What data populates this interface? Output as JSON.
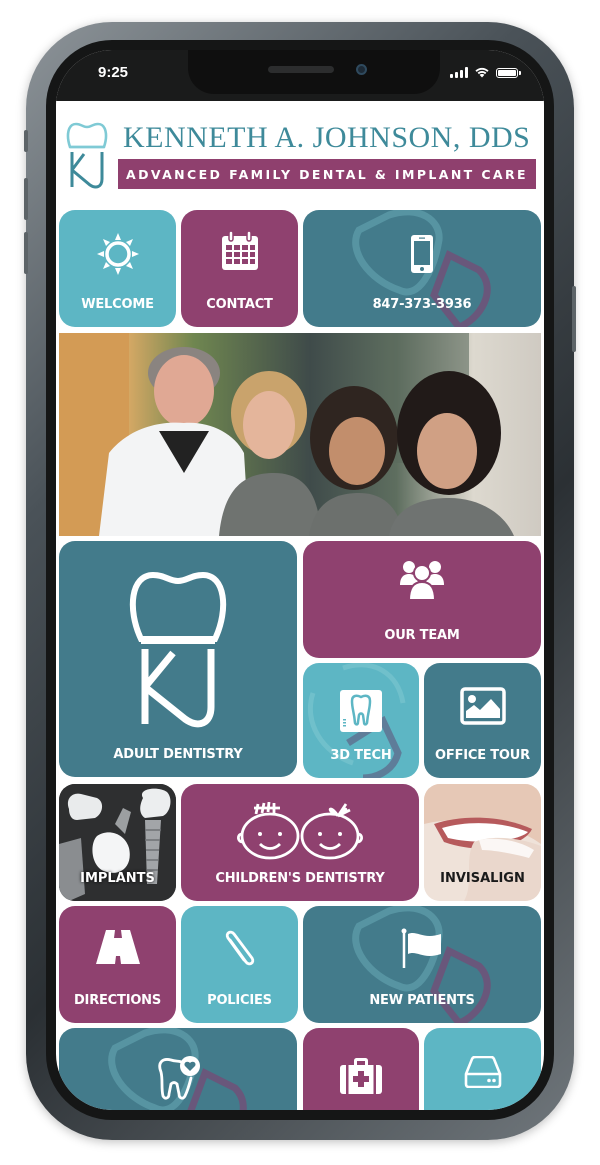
{
  "status_bar": {
    "time": "9:25",
    "icons": [
      "cellular-signal-icon",
      "wifi-icon",
      "battery-icon"
    ]
  },
  "header": {
    "logo_alt": "KJ tooth logo",
    "brand_name": "KENNETH A. JOHNSON, DDS",
    "tagline": "ADVANCED FAMILY DENTAL & IMPLANT CARE"
  },
  "colors": {
    "teal": "#5db6c4",
    "plum": "#8f416f",
    "slate": "#437b8b",
    "brand_text": "#3e8a9a"
  },
  "tiles": {
    "welcome": {
      "label": "WELCOME",
      "icon": "sun-icon"
    },
    "contact": {
      "label": "CONTACT",
      "icon": "calendar-icon"
    },
    "phone": {
      "label": "847-373-3936",
      "icon": "smartphone-icon"
    },
    "team_photo": {
      "alt": "Dental team photo"
    },
    "adult_dentistry": {
      "label": "ADULT DENTISTRY",
      "icon": "kj-tooth-logo-icon"
    },
    "our_team": {
      "label": "OUR TEAM",
      "icon": "group-icon"
    },
    "tech_3d": {
      "label": "3D TECH",
      "icon": "tooth-xray-icon"
    },
    "office_tour": {
      "label": "OFFICE TOUR",
      "icon": "image-icon"
    },
    "implants": {
      "label": "IMPLANTS",
      "icon": "dental-implants-photo"
    },
    "childrens_dentistry": {
      "label": "CHILDREN'S DENTISTRY",
      "icon": "baby-faces-icon"
    },
    "invisalign": {
      "label": "INVISALIGN",
      "icon": "clear-aligner-photo"
    },
    "directions": {
      "label": "DIRECTIONS",
      "icon": "road-icon"
    },
    "policies": {
      "label": "POLICIES",
      "icon": "paperclip-icon"
    },
    "new_patients": {
      "label": "NEW PATIENTS",
      "icon": "flag-icon"
    },
    "dental_care": {
      "label": "",
      "icon": "tooth-heart-icon"
    },
    "emergency": {
      "label": "",
      "icon": "first-aid-kit-icon"
    },
    "records": {
      "label": "",
      "icon": "hard-drive-icon"
    }
  }
}
